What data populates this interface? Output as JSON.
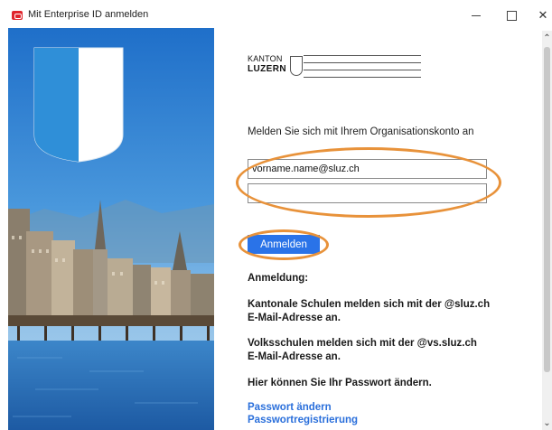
{
  "window": {
    "title": "Mit Enterprise ID anmelden",
    "minimize_icon": "minimize-icon",
    "maximize_icon": "maximize-icon",
    "close_icon": "close-icon"
  },
  "logo": {
    "line1": "KANTON",
    "line2": "LUZERN"
  },
  "form": {
    "prompt": "Melden Sie sich mit Ihrem Organisationskonto an",
    "username_value": "vorname.name@sluz.ch",
    "password_value": "",
    "login_label": "Anmelden"
  },
  "info": {
    "heading": "Anmeldung:",
    "block1_line1": "Kantonale Schulen melden sich mit der @sluz.ch",
    "block1_line2": "E-Mail-Adresse an.",
    "block2_line1": "Volksschulen melden sich mit der @vs.sluz.ch",
    "block2_line2": "E-Mail-Adresse an.",
    "block3": "Hier können Sie Ihr Passwort ändern.",
    "link1": "Passwort ändern",
    "link2": "Passwortregistrierung"
  },
  "colors": {
    "accent": "#2a73e8",
    "annotation": "#e8923a",
    "link": "#2a6fdb",
    "shield_blue": "#2f8fd8"
  }
}
